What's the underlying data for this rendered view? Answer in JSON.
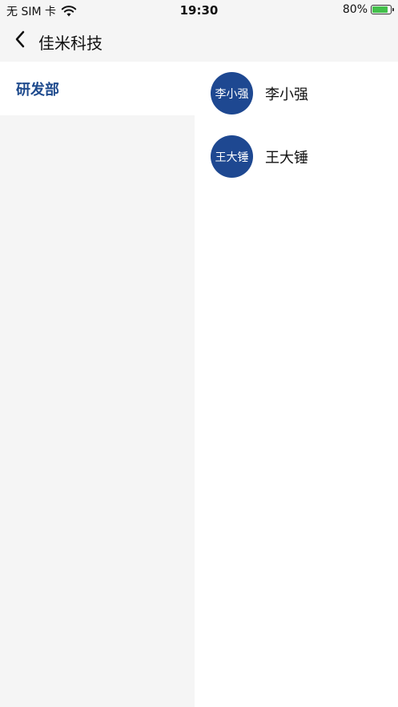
{
  "status_bar": {
    "carrier": "无 SIM 卡",
    "time": "19:30",
    "battery": "80%",
    "icons": [
      "wifi-icon",
      "battery-charging-icon"
    ]
  },
  "nav": {
    "back_icon": "chevron-left-icon",
    "title": "佳米科技"
  },
  "sidebar": {
    "items": [
      {
        "label": "研发部",
        "active": true
      }
    ]
  },
  "members": [
    {
      "avatar_text": "李小强",
      "name": "李小强"
    },
    {
      "avatar_text": "王大锤",
      "name": "王大锤"
    }
  ],
  "colors": {
    "accent": "#1e4a8d",
    "avatar_bg": "#1e4891",
    "sidebar_bg": "#f5f5f5"
  }
}
